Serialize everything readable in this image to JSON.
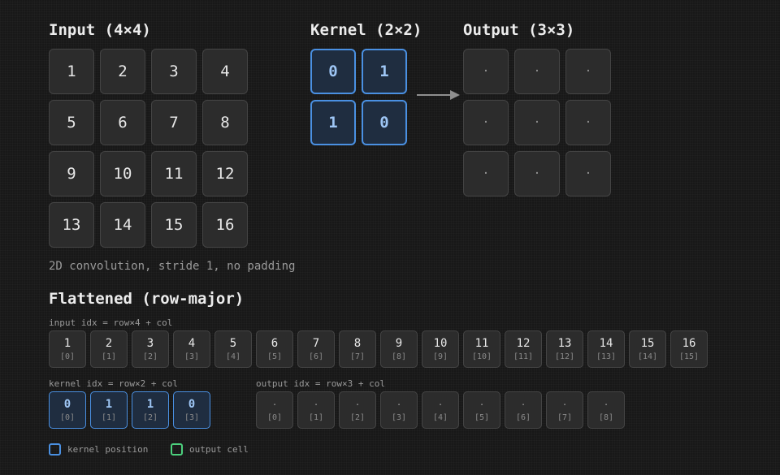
{
  "input": {
    "title": "Input (4×4)",
    "cells": [
      "1",
      "2",
      "3",
      "4",
      "5",
      "6",
      "7",
      "8",
      "9",
      "10",
      "11",
      "12",
      "13",
      "14",
      "15",
      "16"
    ]
  },
  "kernel": {
    "title": "Kernel (2×2)",
    "cells": [
      "0",
      "1",
      "1",
      "0"
    ]
  },
  "output": {
    "title": "Output (3×3)",
    "cells": [
      "·",
      "·",
      "·",
      "·",
      "·",
      "·",
      "·",
      "·",
      "·"
    ]
  },
  "caption": "2D convolution, stride 1, no padding",
  "flattened": {
    "title": "Flattened (row-major)",
    "input": {
      "label": "input   idx = row×4 + col",
      "values": [
        "1",
        "2",
        "3",
        "4",
        "5",
        "6",
        "7",
        "8",
        "9",
        "10",
        "11",
        "12",
        "13",
        "14",
        "15",
        "16"
      ],
      "indices": [
        "[0]",
        "[1]",
        "[2]",
        "[3]",
        "[4]",
        "[5]",
        "[6]",
        "[7]",
        "[8]",
        "[9]",
        "[10]",
        "[11]",
        "[12]",
        "[13]",
        "[14]",
        "[15]"
      ]
    },
    "kernel": {
      "label": "kernel  idx = row×2 + col",
      "values": [
        "0",
        "1",
        "1",
        "0"
      ],
      "indices": [
        "[0]",
        "[1]",
        "[2]",
        "[3]"
      ]
    },
    "output": {
      "label": "output  idx = row×3 + col",
      "values": [
        "·",
        "·",
        "·",
        "·",
        "·",
        "·",
        "·",
        "·",
        "·"
      ],
      "indices": [
        "[0]",
        "[1]",
        "[2]",
        "[3]",
        "[4]",
        "[5]",
        "[6]",
        "[7]",
        "[8]"
      ]
    }
  },
  "legend": {
    "kernel_label": "kernel position",
    "output_label": "output cell"
  },
  "colors": {
    "kernel_accent": "#4a90e2",
    "output_accent": "#4cd07d",
    "background": "#181818",
    "cell_fill": "#2c2c2c"
  }
}
